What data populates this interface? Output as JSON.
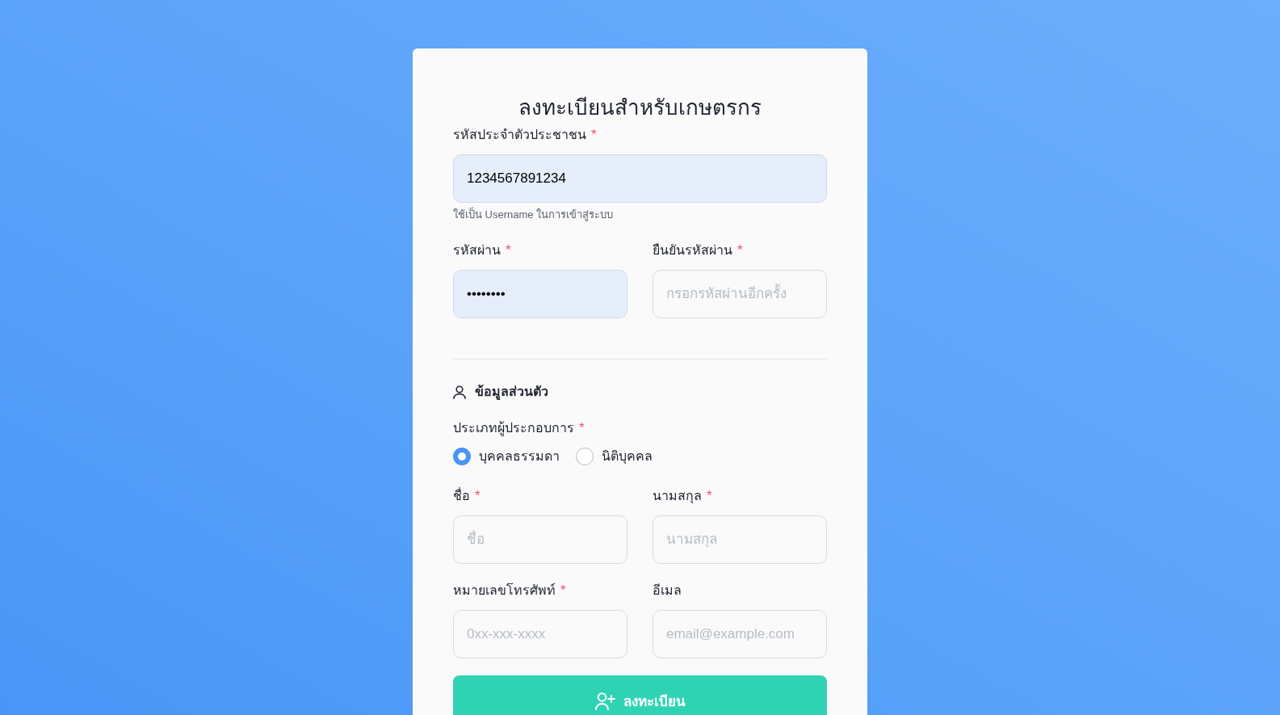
{
  "form": {
    "title": "ลงทะเบียนสำหรับเกษตรกร",
    "national_id": {
      "label": "รหัสประจำตัวประชาชน",
      "required_mark": "*",
      "value": "1234567891234",
      "autofilled": true,
      "hint": "ใช้เป็น Username ในการเข้าสู่ระบบ"
    },
    "password_fields": [
      {
        "label": "รหัสผ่าน",
        "required_mark": "*",
        "value": "••••••••",
        "autofilled": true
      },
      {
        "label": "ยืนยันรหัสผ่าน",
        "required_mark": "*",
        "placeholder": "กรอกรหัสผ่านอีกครั้ง",
        "autofilled": false
      }
    ],
    "personal_section": {
      "heading": "ข้อมูลส่วนตัว",
      "operator_type": {
        "label": "ประเภทผู้ประกอบการ",
        "required_mark": "*",
        "options": [
          {
            "label": "บุคคลธรรมดา",
            "selected": true
          },
          {
            "label": "นิติบุคคล",
            "selected": false
          }
        ]
      },
      "name_fields": [
        {
          "label": "ชื่อ",
          "required_mark": "*",
          "placeholder": "ชื่อ",
          "autofilled": false
        },
        {
          "label": "นามสกุล",
          "required_mark": "*",
          "placeholder": "นามสกุล",
          "autofilled": false
        }
      ],
      "contact_fields": [
        {
          "label": "หมายเลขโทรศัพท์",
          "required_mark": "*",
          "placeholder": "0xx-xxx-xxxx",
          "autofilled": false
        },
        {
          "label": "อีเมล",
          "placeholder": "email@example.com",
          "autofilled": false
        }
      ]
    },
    "submit_button": {
      "label": "ลงทะเบียน"
    }
  }
}
